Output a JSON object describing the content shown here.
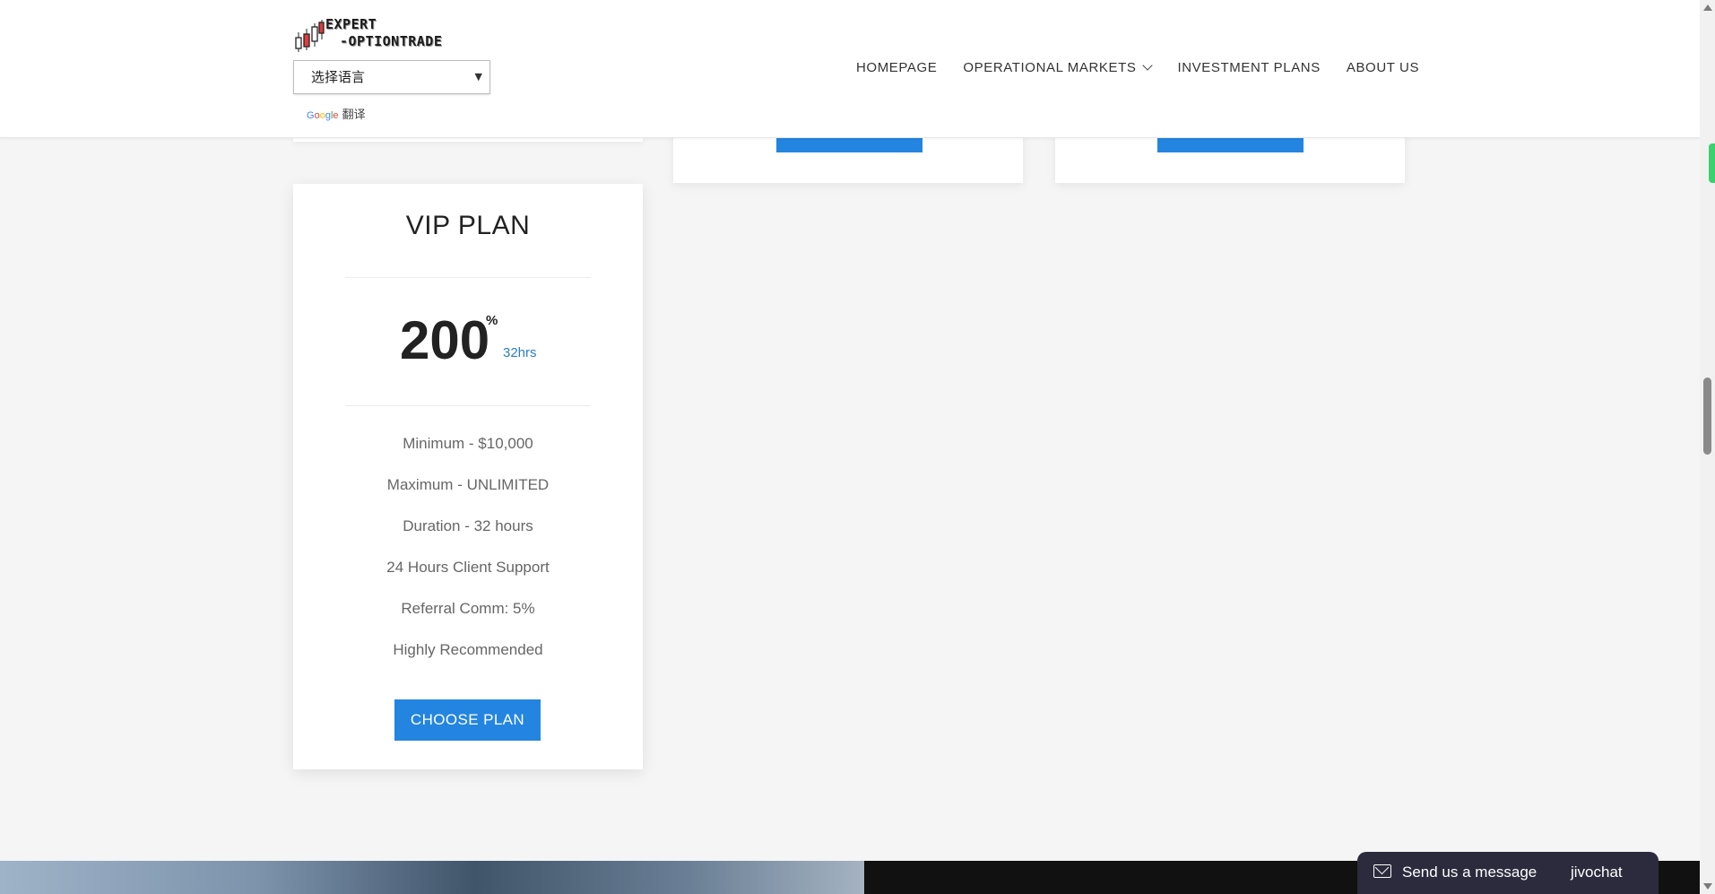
{
  "header": {
    "logo": {
      "line1": "EXPERT",
      "line2": "-OPTIONTRADE"
    },
    "language_select": {
      "value": "选择语言"
    },
    "google_translate": {
      "brand": [
        "G",
        "o",
        "o",
        "g",
        "l",
        "e"
      ],
      "label": "翻译"
    },
    "nav": {
      "items": [
        {
          "label": "HOMEPAGE"
        },
        {
          "label": "OPERATIONAL MARKETS"
        },
        {
          "label": "INVESTMENT PLANS"
        },
        {
          "label": "ABOUT US"
        }
      ]
    }
  },
  "vip_plan": {
    "title": "VIP PLAN",
    "rate": "200",
    "rate_unit": "%",
    "duration_short": "32hrs",
    "features": [
      "Minimum - $10,000",
      "Maximum - UNLIMITED",
      "Duration - 32 hours",
      "24 Hours Client Support",
      "Referral Comm: 5%",
      "Highly Recommended"
    ],
    "button_label": "CHOOSE PLAN"
  },
  "chat_widget": {
    "message": "Send us a message",
    "brand": "jivochat"
  },
  "colors": {
    "accent": "#2385e0",
    "chat_bg": "#2b2b3d",
    "page_bg": "#f5f5f5"
  }
}
